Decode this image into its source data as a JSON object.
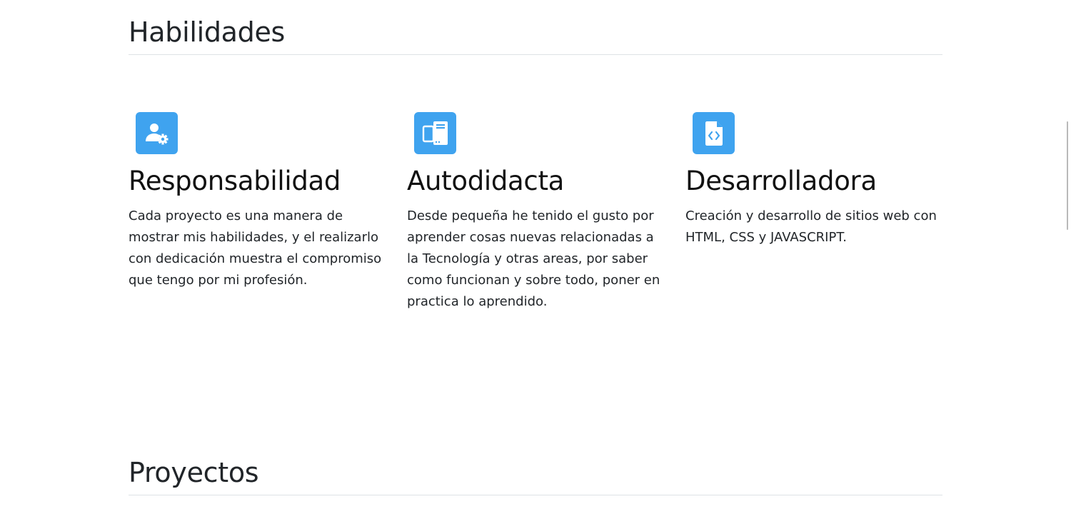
{
  "sections": {
    "skills_title": "Habilidades",
    "projects_title": "Proyectos"
  },
  "skills": [
    {
      "icon": "user-gear-icon",
      "title": "Responsabilidad",
      "text": "Cada proyecto es una manera de mostrar mis habilidades, y el realizarlo con dedicación muestra el compromiso que tengo por mi profesión."
    },
    {
      "icon": "devices-icon",
      "title": "Autodidacta",
      "text": "Desde pequeña he tenido el gusto por aprender cosas nuevas relacionadas a la Tecnología y otras areas, por saber como funcionan y sobre todo, poner en practica lo aprendido."
    },
    {
      "icon": "code-file-icon",
      "title": "Desarrolladora",
      "text": "Creación y desarrollo de sitios web con HTML, CSS y JAVASCRIPT."
    }
  ],
  "colors": {
    "icon_background": "#3fa3ef",
    "divider": "#dee2e6",
    "text": "#212529"
  }
}
